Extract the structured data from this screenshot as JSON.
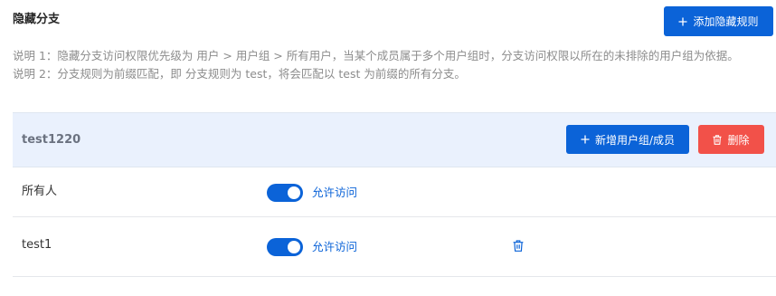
{
  "header": {
    "title": "隐藏分支",
    "add_rule_label": "添加隐藏规则"
  },
  "description": {
    "line1": "说明 1：隐藏分支访问权限优先级为 用户 > 用户组 > 所有用户，当某个成员属于多个用户组时，分支访问权限以所在的未排除的用户组为依据。",
    "line2": "说明 2：分支规则为前缀匹配，即 分支规则为 test，将会匹配以 test 为前缀的所有分支。"
  },
  "rule": {
    "name": "test1220",
    "add_member_label": "新增用户组/成员",
    "delete_label": "删除",
    "members": [
      {
        "name": "所有人",
        "access_enabled": true,
        "access_label": "允许访问",
        "deletable": false
      },
      {
        "name": "test1",
        "access_enabled": true,
        "access_label": "允许访问",
        "deletable": true
      }
    ]
  },
  "colors": {
    "primary": "#0b63d8",
    "danger": "#f25149",
    "group_header_bg": "#eaf1fd",
    "muted_text": "#8c8c8c"
  },
  "icons": {
    "add": "plus-icon",
    "delete": "trash-icon"
  }
}
